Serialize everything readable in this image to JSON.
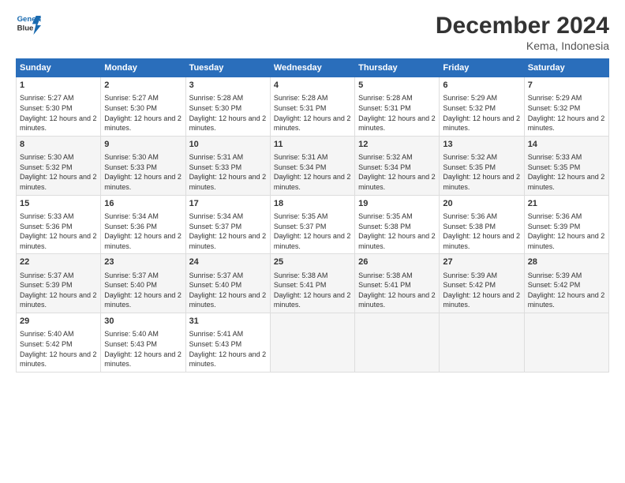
{
  "logo": {
    "line1": "General",
    "line2": "Blue"
  },
  "title": "December 2024",
  "subtitle": "Kema, Indonesia",
  "days_of_week": [
    "Sunday",
    "Monday",
    "Tuesday",
    "Wednesday",
    "Thursday",
    "Friday",
    "Saturday"
  ],
  "rows": [
    [
      {
        "day": "1",
        "sunrise": "5:27 AM",
        "sunset": "5:30 PM",
        "daylight": "12 hours and 2 minutes."
      },
      {
        "day": "2",
        "sunrise": "5:27 AM",
        "sunset": "5:30 PM",
        "daylight": "12 hours and 2 minutes."
      },
      {
        "day": "3",
        "sunrise": "5:28 AM",
        "sunset": "5:30 PM",
        "daylight": "12 hours and 2 minutes."
      },
      {
        "day": "4",
        "sunrise": "5:28 AM",
        "sunset": "5:31 PM",
        "daylight": "12 hours and 2 minutes."
      },
      {
        "day": "5",
        "sunrise": "5:28 AM",
        "sunset": "5:31 PM",
        "daylight": "12 hours and 2 minutes."
      },
      {
        "day": "6",
        "sunrise": "5:29 AM",
        "sunset": "5:32 PM",
        "daylight": "12 hours and 2 minutes."
      },
      {
        "day": "7",
        "sunrise": "5:29 AM",
        "sunset": "5:32 PM",
        "daylight": "12 hours and 2 minutes."
      }
    ],
    [
      {
        "day": "8",
        "sunrise": "5:30 AM",
        "sunset": "5:32 PM",
        "daylight": "12 hours and 2 minutes."
      },
      {
        "day": "9",
        "sunrise": "5:30 AM",
        "sunset": "5:33 PM",
        "daylight": "12 hours and 2 minutes."
      },
      {
        "day": "10",
        "sunrise": "5:31 AM",
        "sunset": "5:33 PM",
        "daylight": "12 hours and 2 minutes."
      },
      {
        "day": "11",
        "sunrise": "5:31 AM",
        "sunset": "5:34 PM",
        "daylight": "12 hours and 2 minutes."
      },
      {
        "day": "12",
        "sunrise": "5:32 AM",
        "sunset": "5:34 PM",
        "daylight": "12 hours and 2 minutes."
      },
      {
        "day": "13",
        "sunrise": "5:32 AM",
        "sunset": "5:35 PM",
        "daylight": "12 hours and 2 minutes."
      },
      {
        "day": "14",
        "sunrise": "5:33 AM",
        "sunset": "5:35 PM",
        "daylight": "12 hours and 2 minutes."
      }
    ],
    [
      {
        "day": "15",
        "sunrise": "5:33 AM",
        "sunset": "5:36 PM",
        "daylight": "12 hours and 2 minutes."
      },
      {
        "day": "16",
        "sunrise": "5:34 AM",
        "sunset": "5:36 PM",
        "daylight": "12 hours and 2 minutes."
      },
      {
        "day": "17",
        "sunrise": "5:34 AM",
        "sunset": "5:37 PM",
        "daylight": "12 hours and 2 minutes."
      },
      {
        "day": "18",
        "sunrise": "5:35 AM",
        "sunset": "5:37 PM",
        "daylight": "12 hours and 2 minutes."
      },
      {
        "day": "19",
        "sunrise": "5:35 AM",
        "sunset": "5:38 PM",
        "daylight": "12 hours and 2 minutes."
      },
      {
        "day": "20",
        "sunrise": "5:36 AM",
        "sunset": "5:38 PM",
        "daylight": "12 hours and 2 minutes."
      },
      {
        "day": "21",
        "sunrise": "5:36 AM",
        "sunset": "5:39 PM",
        "daylight": "12 hours and 2 minutes."
      }
    ],
    [
      {
        "day": "22",
        "sunrise": "5:37 AM",
        "sunset": "5:39 PM",
        "daylight": "12 hours and 2 minutes."
      },
      {
        "day": "23",
        "sunrise": "5:37 AM",
        "sunset": "5:40 PM",
        "daylight": "12 hours and 2 minutes."
      },
      {
        "day": "24",
        "sunrise": "5:37 AM",
        "sunset": "5:40 PM",
        "daylight": "12 hours and 2 minutes."
      },
      {
        "day": "25",
        "sunrise": "5:38 AM",
        "sunset": "5:41 PM",
        "daylight": "12 hours and 2 minutes."
      },
      {
        "day": "26",
        "sunrise": "5:38 AM",
        "sunset": "5:41 PM",
        "daylight": "12 hours and 2 minutes."
      },
      {
        "day": "27",
        "sunrise": "5:39 AM",
        "sunset": "5:42 PM",
        "daylight": "12 hours and 2 minutes."
      },
      {
        "day": "28",
        "sunrise": "5:39 AM",
        "sunset": "5:42 PM",
        "daylight": "12 hours and 2 minutes."
      }
    ],
    [
      {
        "day": "29",
        "sunrise": "5:40 AM",
        "sunset": "5:42 PM",
        "daylight": "12 hours and 2 minutes."
      },
      {
        "day": "30",
        "sunrise": "5:40 AM",
        "sunset": "5:43 PM",
        "daylight": "12 hours and 2 minutes."
      },
      {
        "day": "31",
        "sunrise": "5:41 AM",
        "sunset": "5:43 PM",
        "daylight": "12 hours and 2 minutes."
      },
      null,
      null,
      null,
      null
    ]
  ]
}
